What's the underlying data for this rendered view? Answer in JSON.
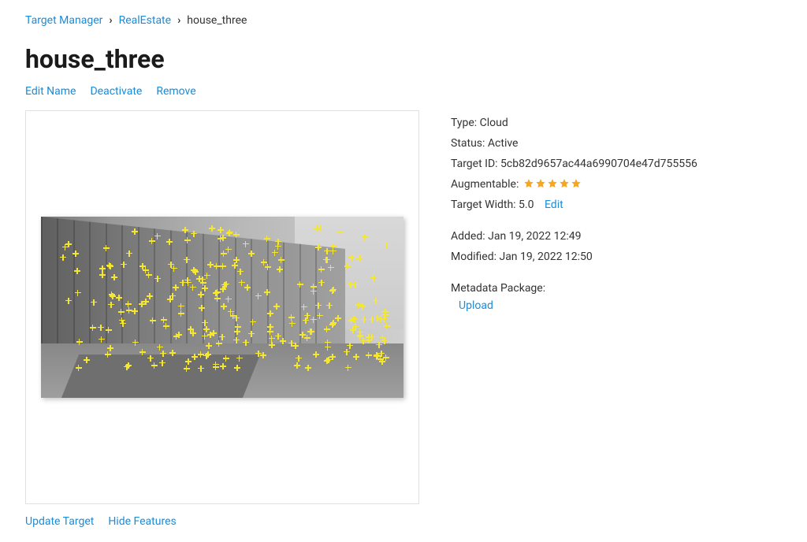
{
  "breadcrumb": {
    "root": "Target Manager",
    "db": "RealEstate",
    "current": "house_three"
  },
  "title": "house_three",
  "actions": {
    "edit_name": "Edit Name",
    "deactivate": "Deactivate",
    "remove": "Remove"
  },
  "below": {
    "update_target": "Update Target",
    "hide_features": "Hide Features"
  },
  "meta": {
    "type_label": "Type:",
    "type_value": "Cloud",
    "status_label": "Status:",
    "status_value": "Active",
    "target_id_label": "Target ID:",
    "target_id_value": "5cb82d9657ac44a6990704e47d755556",
    "augmentable_label": "Augmentable:",
    "rating": 5,
    "width_label": "Target Width:",
    "width_value": "5.0",
    "width_edit": "Edit",
    "added_label": "Added:",
    "added_value": "Jan 19, 2022 12:49",
    "modified_label": "Modified:",
    "modified_value": "Jan 19, 2022 12:50",
    "metadata_label": "Metadata Package:",
    "upload": "Upload"
  }
}
